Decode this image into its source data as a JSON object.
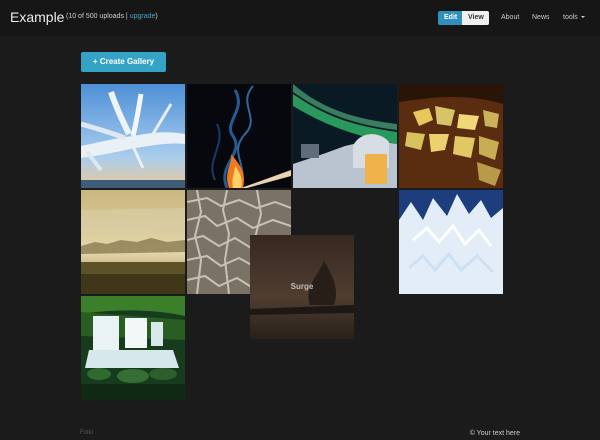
{
  "navbar": {
    "brand": "Example",
    "uploads_prefix": "(10 of 500 uploads |",
    "upgrade_link": "upgrade",
    "uploads_suffix": ")",
    "edit_label": "Edit",
    "view_label": "View",
    "about_label": "About",
    "news_label": "News",
    "tools_label": "tools"
  },
  "toolbar": {
    "create_gallery_label": "+ Create Gallery"
  },
  "gallery": {
    "items": [
      {
        "name": "frozen-branch-photo"
      },
      {
        "name": "blue-smoke-flame-photo"
      },
      {
        "name": "aurora-over-observatory-photo"
      },
      {
        "name": "golden-ice-shards-photo"
      },
      {
        "name": "misty-meadow-photo"
      },
      {
        "name": "cracked-earth-photo"
      },
      {
        "name": "ice-crystals-photo"
      },
      {
        "name": "waterfall-forest-photo"
      },
      {
        "name": "surge-photo",
        "caption": "Surge"
      }
    ]
  },
  "footer": {
    "logo_text": "Fotki",
    "copyright": "© Your text here"
  }
}
